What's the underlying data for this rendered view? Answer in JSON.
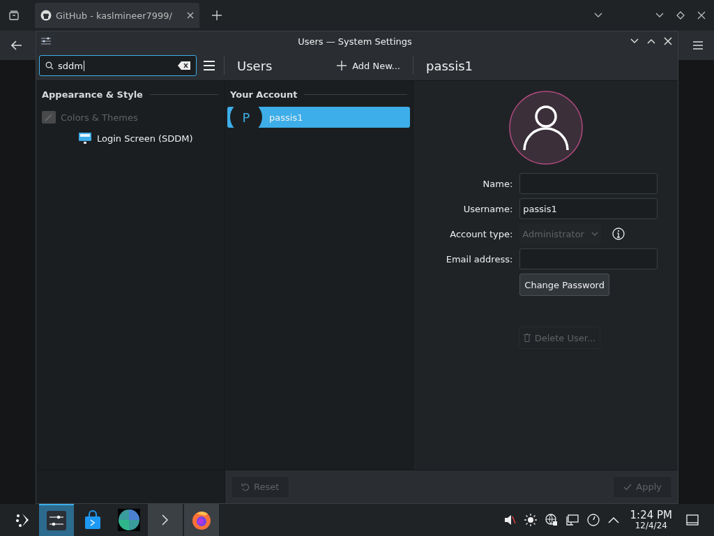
{
  "browser": {
    "tab_title": "GitHub - kaslmineer7999/"
  },
  "window": {
    "title": "Users — System Settings"
  },
  "search": {
    "value": "sddm"
  },
  "sidebar": {
    "section": "Appearance & Style",
    "items": [
      {
        "label": "Colors & Themes",
        "disabled": true,
        "children": [
          {
            "label": "Login Screen (SDDM)",
            "disabled": false
          }
        ]
      }
    ]
  },
  "users_panel": {
    "title": "Users",
    "add_button": "Add New...",
    "section": "Your Account",
    "users": [
      {
        "initial": "P",
        "name": "passis1",
        "selected": true
      }
    ]
  },
  "details": {
    "title": "passis1",
    "fields": [
      {
        "kind": "text",
        "label": "Name:"
      },
      {
        "kind": "text",
        "label": "Username:",
        "value": "passis1"
      },
      {
        "kind": "select",
        "label": "Account type:",
        "value": "Administrator",
        "disabled": true
      },
      {
        "kind": "text",
        "label": "Email address:"
      }
    ],
    "change_password": "Change Password",
    "delete_button": {
      "label": "Delete User...",
      "disabled": true
    }
  },
  "footer": {
    "reset": {
      "label": "Reset",
      "disabled": true
    },
    "apply": {
      "label": "Apply",
      "disabled": true
    }
  },
  "taskbar": {
    "tasks": [
      {
        "kind": "settings",
        "selected": true
      },
      {
        "kind": "store",
        "selected": false
      },
      {
        "kind": "globe",
        "selected": false
      },
      {
        "kind": "terminal",
        "selected": false
      },
      {
        "kind": "firefox",
        "selected": false
      }
    ],
    "time": "1:24 PM",
    "date": "12/4/24"
  }
}
